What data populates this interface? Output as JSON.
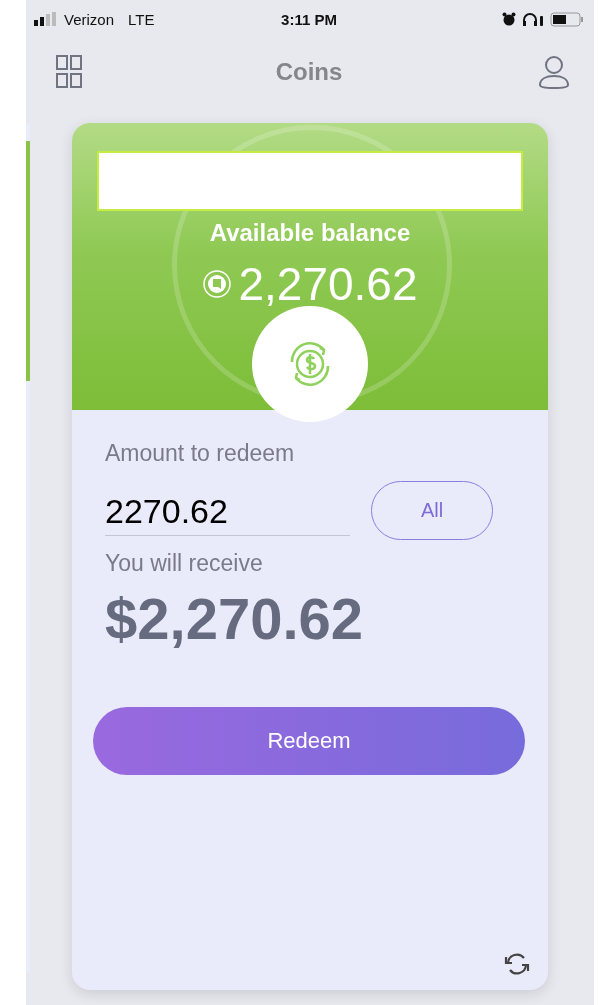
{
  "status_bar": {
    "carrier": "Verizon",
    "network": "LTE",
    "time": "3:11 PM"
  },
  "nav": {
    "title": "Coins"
  },
  "balance": {
    "label": "Available balance",
    "amount": "2,270.62"
  },
  "redeem": {
    "amount_label": "Amount to redeem",
    "amount_value": "2270.62",
    "all_button": "All",
    "receive_label": "You will receive",
    "receive_amount": "$2,270.62",
    "redeem_button": "Redeem"
  }
}
